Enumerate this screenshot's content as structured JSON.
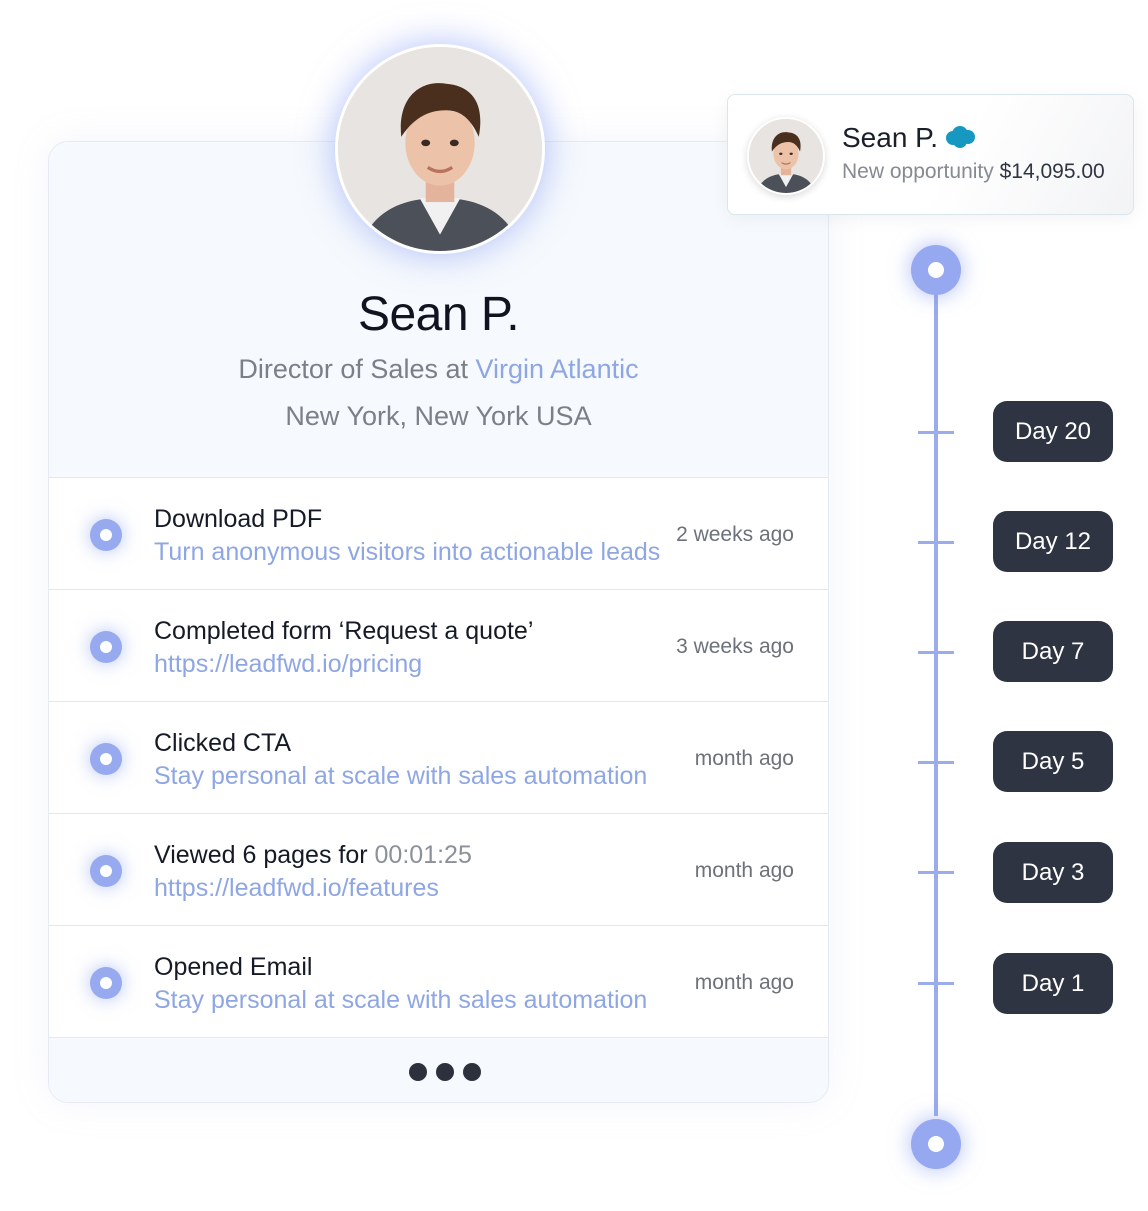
{
  "profile": {
    "name": "Sean P.",
    "title_prefix": "Director of Sales at",
    "company": "Virgin Atlantic",
    "location": "New York, New York USA",
    "avatar_icon": "person-photo"
  },
  "activities": [
    {
      "title": "Download PDF",
      "title_extra": "",
      "subtitle": "Turn anonymous visitors into actionable leads",
      "time": "2 weeks ago"
    },
    {
      "title": "Completed form ‘Request a quote’",
      "title_extra": "",
      "subtitle": "https://leadfwd.io/pricing",
      "time": "3 weeks ago"
    },
    {
      "title": "Clicked CTA",
      "title_extra": "",
      "subtitle": "Stay personal at scale with sales automation",
      "time": "month ago"
    },
    {
      "title": "Viewed 6 pages for",
      "title_extra": "00:01:25",
      "subtitle": "https://leadfwd.io/features",
      "time": "month ago"
    },
    {
      "title": "Opened Email",
      "title_extra": "",
      "subtitle": "Stay personal at scale with sales automation",
      "time": "month ago"
    }
  ],
  "notification": {
    "name": "Sean P.",
    "label": "New opportunity",
    "amount": "$14,095.00",
    "icon": "salesforce-cloud-icon",
    "icon_color": "#1798c1"
  },
  "timeline": {
    "days": [
      "Day 20",
      "Day 12",
      "Day 7",
      "Day 5",
      "Day 3",
      "Day 1"
    ]
  },
  "colors": {
    "accent": "#97aaf0",
    "link": "#8ea6e3",
    "pill": "#2e3441"
  }
}
